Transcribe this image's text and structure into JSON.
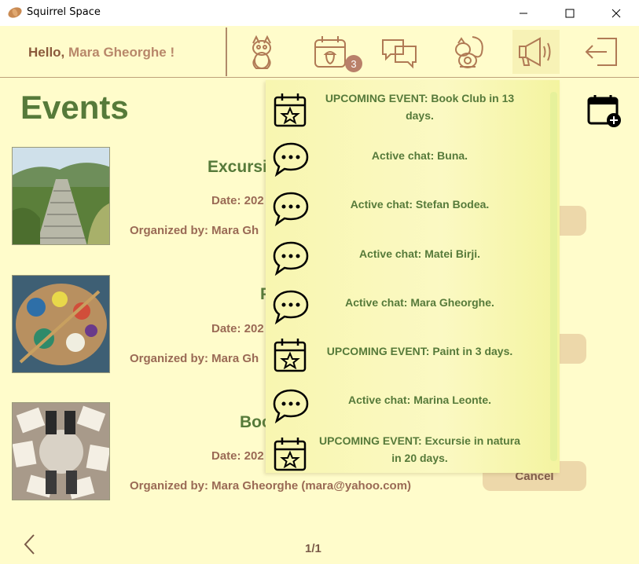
{
  "window": {
    "title": "Squirrel Space"
  },
  "header": {
    "greeting_prefix": "Hello,",
    "greeting_name": "Mara Gheorghe !",
    "notification_count": "3",
    "nav_icons": [
      "squirrel-profile-icon",
      "calendar-acorn-icon",
      "chat-bubbles-icon",
      "squirrel-puzzle-icon",
      "megaphone-icon",
      "logout-icon"
    ]
  },
  "page": {
    "title": "Events",
    "pagination": "1/1"
  },
  "events": [
    {
      "title_visible": "Excursi",
      "date_visible": "Date: 202",
      "organizer_visible": "Organized by: Mara Gh",
      "button_label": "",
      "image": "mountain-stairs-photo"
    },
    {
      "title_visible": "P",
      "date_visible": "Date: 202",
      "organizer_visible": "Organized by: Mara Gh",
      "button_label": "",
      "image": "paint-palette-photo"
    },
    {
      "title_visible": "Boo",
      "date_visible": "Date: 202",
      "organizer_visible": "Organized by: Mara Gheorghe (mara@yahoo.com)",
      "button_label": "Cancel",
      "image": "book-club-photo"
    }
  ],
  "notifications": [
    {
      "type": "event",
      "text": "UPCOMING EVENT: Book Club in 13 days."
    },
    {
      "type": "chat",
      "text": "Active chat: Buna."
    },
    {
      "type": "chat",
      "text": "Active chat: Stefan Bodea."
    },
    {
      "type": "chat",
      "text": "Active chat: Matei Birji."
    },
    {
      "type": "chat",
      "text": "Active chat: Mara Gheorghe."
    },
    {
      "type": "event",
      "text": "UPCOMING EVENT: Paint in 3 days."
    },
    {
      "type": "chat",
      "text": "Active chat: Marina Leonte."
    },
    {
      "type": "event",
      "text": "UPCOMING EVENT: Excursie in natura in 20 days."
    }
  ],
  "colors": {
    "background": "#FFFCCB",
    "title_green": "#567A3A",
    "text_brown": "#9A6A55",
    "button_tan": "#EDD8AA"
  }
}
